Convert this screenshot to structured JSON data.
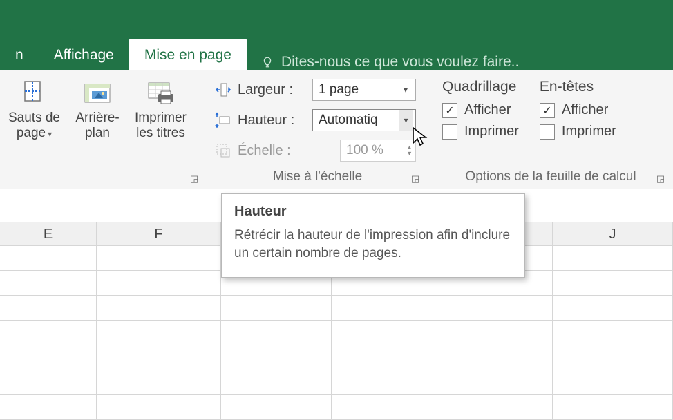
{
  "colors": {
    "brand": "#217346"
  },
  "tabs": {
    "prev_partial": "n",
    "view": "Affichage",
    "layout": "Mise en page"
  },
  "tell_me": "Dites-nous ce que vous voulez faire..",
  "page_setup": {
    "breaks_l1": "Sauts de",
    "breaks_l2": "page",
    "bg_l1": "Arrière-",
    "bg_l2": "plan",
    "titles_l1": "Imprimer",
    "titles_l2": "les titres"
  },
  "scale": {
    "width_label": "Largeur :",
    "width_value": "1 page",
    "height_label": "Hauteur :",
    "height_value": "Automatiq",
    "scale_label": "Échelle :",
    "scale_value": "100 %",
    "group_label": "Mise à l'échelle"
  },
  "sheet": {
    "grid_head": "Quadrillage",
    "head_head": "En-têtes",
    "show": "Afficher",
    "print": "Imprimer",
    "group_label": "Options de la feuille de calcul"
  },
  "tooltip": {
    "title": "Hauteur",
    "body": "Rétrécir la hauteur de l'impression afin d'inclure un certain nombre de pages."
  },
  "columns": [
    "E",
    "F",
    "",
    "",
    "",
    "J"
  ]
}
